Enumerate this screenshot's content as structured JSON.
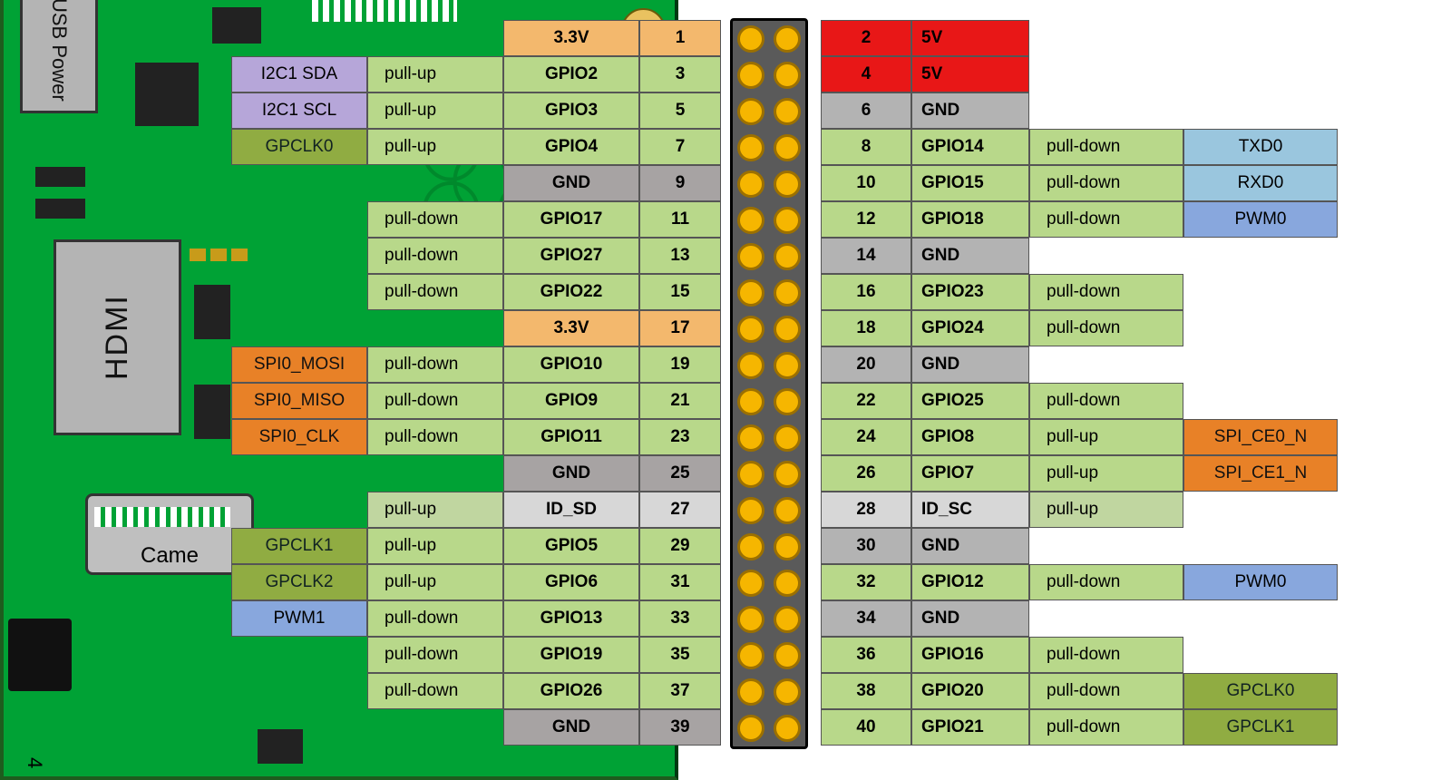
{
  "labels": {
    "usb_power": "USB Power",
    "hdmi": "HDMI",
    "camera": "Came",
    "corner_num": "4"
  },
  "colors": {
    "pcb": "#00a235",
    "header": "#5a5a5a",
    "pin": "#f6b600"
  },
  "pins": {
    "left": [
      {
        "num": "1",
        "name": "3.3V",
        "pull": "",
        "alt": "",
        "nrow": "pwr3v"
      },
      {
        "num": "3",
        "name": "GPIO2",
        "pull": "pull-up",
        "alt": "I2C1 SDA",
        "altc": "purple",
        "nrow": "gpio"
      },
      {
        "num": "5",
        "name": "GPIO3",
        "pull": "pull-up",
        "alt": "I2C1 SCL",
        "altc": "purple",
        "nrow": "gpio"
      },
      {
        "num": "7",
        "name": "GPIO4",
        "pull": "pull-up",
        "alt": "GPCLK0",
        "altc": "olive",
        "nrow": "gpio"
      },
      {
        "num": "9",
        "name": "GND",
        "pull": "",
        "alt": "",
        "nrow": "gnd"
      },
      {
        "num": "11",
        "name": "GPIO17",
        "pull": "pull-down",
        "alt": "",
        "nrow": "gpio"
      },
      {
        "num": "13",
        "name": "GPIO27",
        "pull": "pull-down",
        "alt": "",
        "nrow": "gpio"
      },
      {
        "num": "15",
        "name": "GPIO22",
        "pull": "pull-down",
        "alt": "",
        "nrow": "gpio"
      },
      {
        "num": "17",
        "name": "3.3V",
        "pull": "",
        "alt": "",
        "nrow": "pwr3v"
      },
      {
        "num": "19",
        "name": "GPIO10",
        "pull": "pull-down",
        "alt": "SPI0_MOSI",
        "altc": "orange",
        "nrow": "gpio"
      },
      {
        "num": "21",
        "name": "GPIO9",
        "pull": "pull-down",
        "alt": "SPI0_MISO",
        "altc": "orange",
        "nrow": "gpio"
      },
      {
        "num": "23",
        "name": "GPIO11",
        "pull": "pull-down",
        "alt": "SPI0_CLK",
        "altc": "orange",
        "nrow": "gpio"
      },
      {
        "num": "25",
        "name": "GND",
        "pull": "",
        "alt": "",
        "nrow": "gnd"
      },
      {
        "num": "27",
        "name": "ID_SD",
        "pull": "pull-up",
        "alt": "",
        "nrow": "idsd"
      },
      {
        "num": "29",
        "name": "GPIO5",
        "pull": "pull-up",
        "alt": "GPCLK1",
        "altc": "olive",
        "nrow": "gpio"
      },
      {
        "num": "31",
        "name": "GPIO6",
        "pull": "pull-up",
        "alt": "GPCLK2",
        "altc": "olive",
        "nrow": "gpio"
      },
      {
        "num": "33",
        "name": "GPIO13",
        "pull": "pull-down",
        "alt": "PWM1",
        "altc": "blue2",
        "nrow": "gpio"
      },
      {
        "num": "35",
        "name": "GPIO19",
        "pull": "pull-down",
        "alt": "",
        "nrow": "gpio"
      },
      {
        "num": "37",
        "name": "GPIO26",
        "pull": "pull-down",
        "alt": "",
        "nrow": "gpio"
      },
      {
        "num": "39",
        "name": "GND",
        "pull": "",
        "alt": "",
        "nrow": "gnd"
      }
    ],
    "right": [
      {
        "num": "2",
        "name": "5V",
        "pull": "",
        "alt": "",
        "nrow": "pwr5v"
      },
      {
        "num": "4",
        "name": "5V",
        "pull": "",
        "alt": "",
        "nrow": "pwr5v"
      },
      {
        "num": "6",
        "name": "GND",
        "pull": "",
        "alt": "",
        "nrow": "gnd"
      },
      {
        "num": "8",
        "name": "GPIO14",
        "pull": "pull-down",
        "alt": "TXD0",
        "altc": "blue",
        "nrow": "gpio"
      },
      {
        "num": "10",
        "name": "GPIO15",
        "pull": "pull-down",
        "alt": "RXD0",
        "altc": "blue",
        "nrow": "gpio"
      },
      {
        "num": "12",
        "name": "GPIO18",
        "pull": "pull-down",
        "alt": "PWM0",
        "altc": "blue2",
        "nrow": "gpio"
      },
      {
        "num": "14",
        "name": "GND",
        "pull": "",
        "alt": "",
        "nrow": "gnd"
      },
      {
        "num": "16",
        "name": "GPIO23",
        "pull": "pull-down",
        "alt": "",
        "nrow": "gpio"
      },
      {
        "num": "18",
        "name": "GPIO24",
        "pull": "pull-down",
        "alt": "",
        "nrow": "gpio"
      },
      {
        "num": "20",
        "name": "GND",
        "pull": "",
        "alt": "",
        "nrow": "gnd"
      },
      {
        "num": "22",
        "name": "GPIO25",
        "pull": "pull-down",
        "alt": "",
        "nrow": "gpio"
      },
      {
        "num": "24",
        "name": "GPIO8",
        "pull": "pull-up",
        "alt": "SPI_CE0_N",
        "altc": "orange",
        "nrow": "gpio"
      },
      {
        "num": "26",
        "name": "GPIO7",
        "pull": "pull-up",
        "alt": "SPI_CE1_N",
        "altc": "orange",
        "nrow": "gpio"
      },
      {
        "num": "28",
        "name": "ID_SC",
        "pull": "pull-up",
        "alt": "",
        "nrow": "idsd"
      },
      {
        "num": "30",
        "name": "GND",
        "pull": "",
        "alt": "",
        "nrow": "gnd"
      },
      {
        "num": "32",
        "name": "GPIO12",
        "pull": "pull-down",
        "alt": "PWM0",
        "altc": "blue2",
        "nrow": "gpio"
      },
      {
        "num": "34",
        "name": "GND",
        "pull": "",
        "alt": "",
        "nrow": "gnd"
      },
      {
        "num": "36",
        "name": "GPIO16",
        "pull": "pull-down",
        "alt": "",
        "nrow": "gpio"
      },
      {
        "num": "38",
        "name": "GPIO20",
        "pull": "pull-down",
        "alt": "GPCLK0",
        "altc": "olive",
        "nrow": "gpio"
      },
      {
        "num": "40",
        "name": "GPIO21",
        "pull": "pull-down",
        "alt": "GPCLK1",
        "altc": "olive",
        "nrow": "gpio"
      }
    ]
  }
}
